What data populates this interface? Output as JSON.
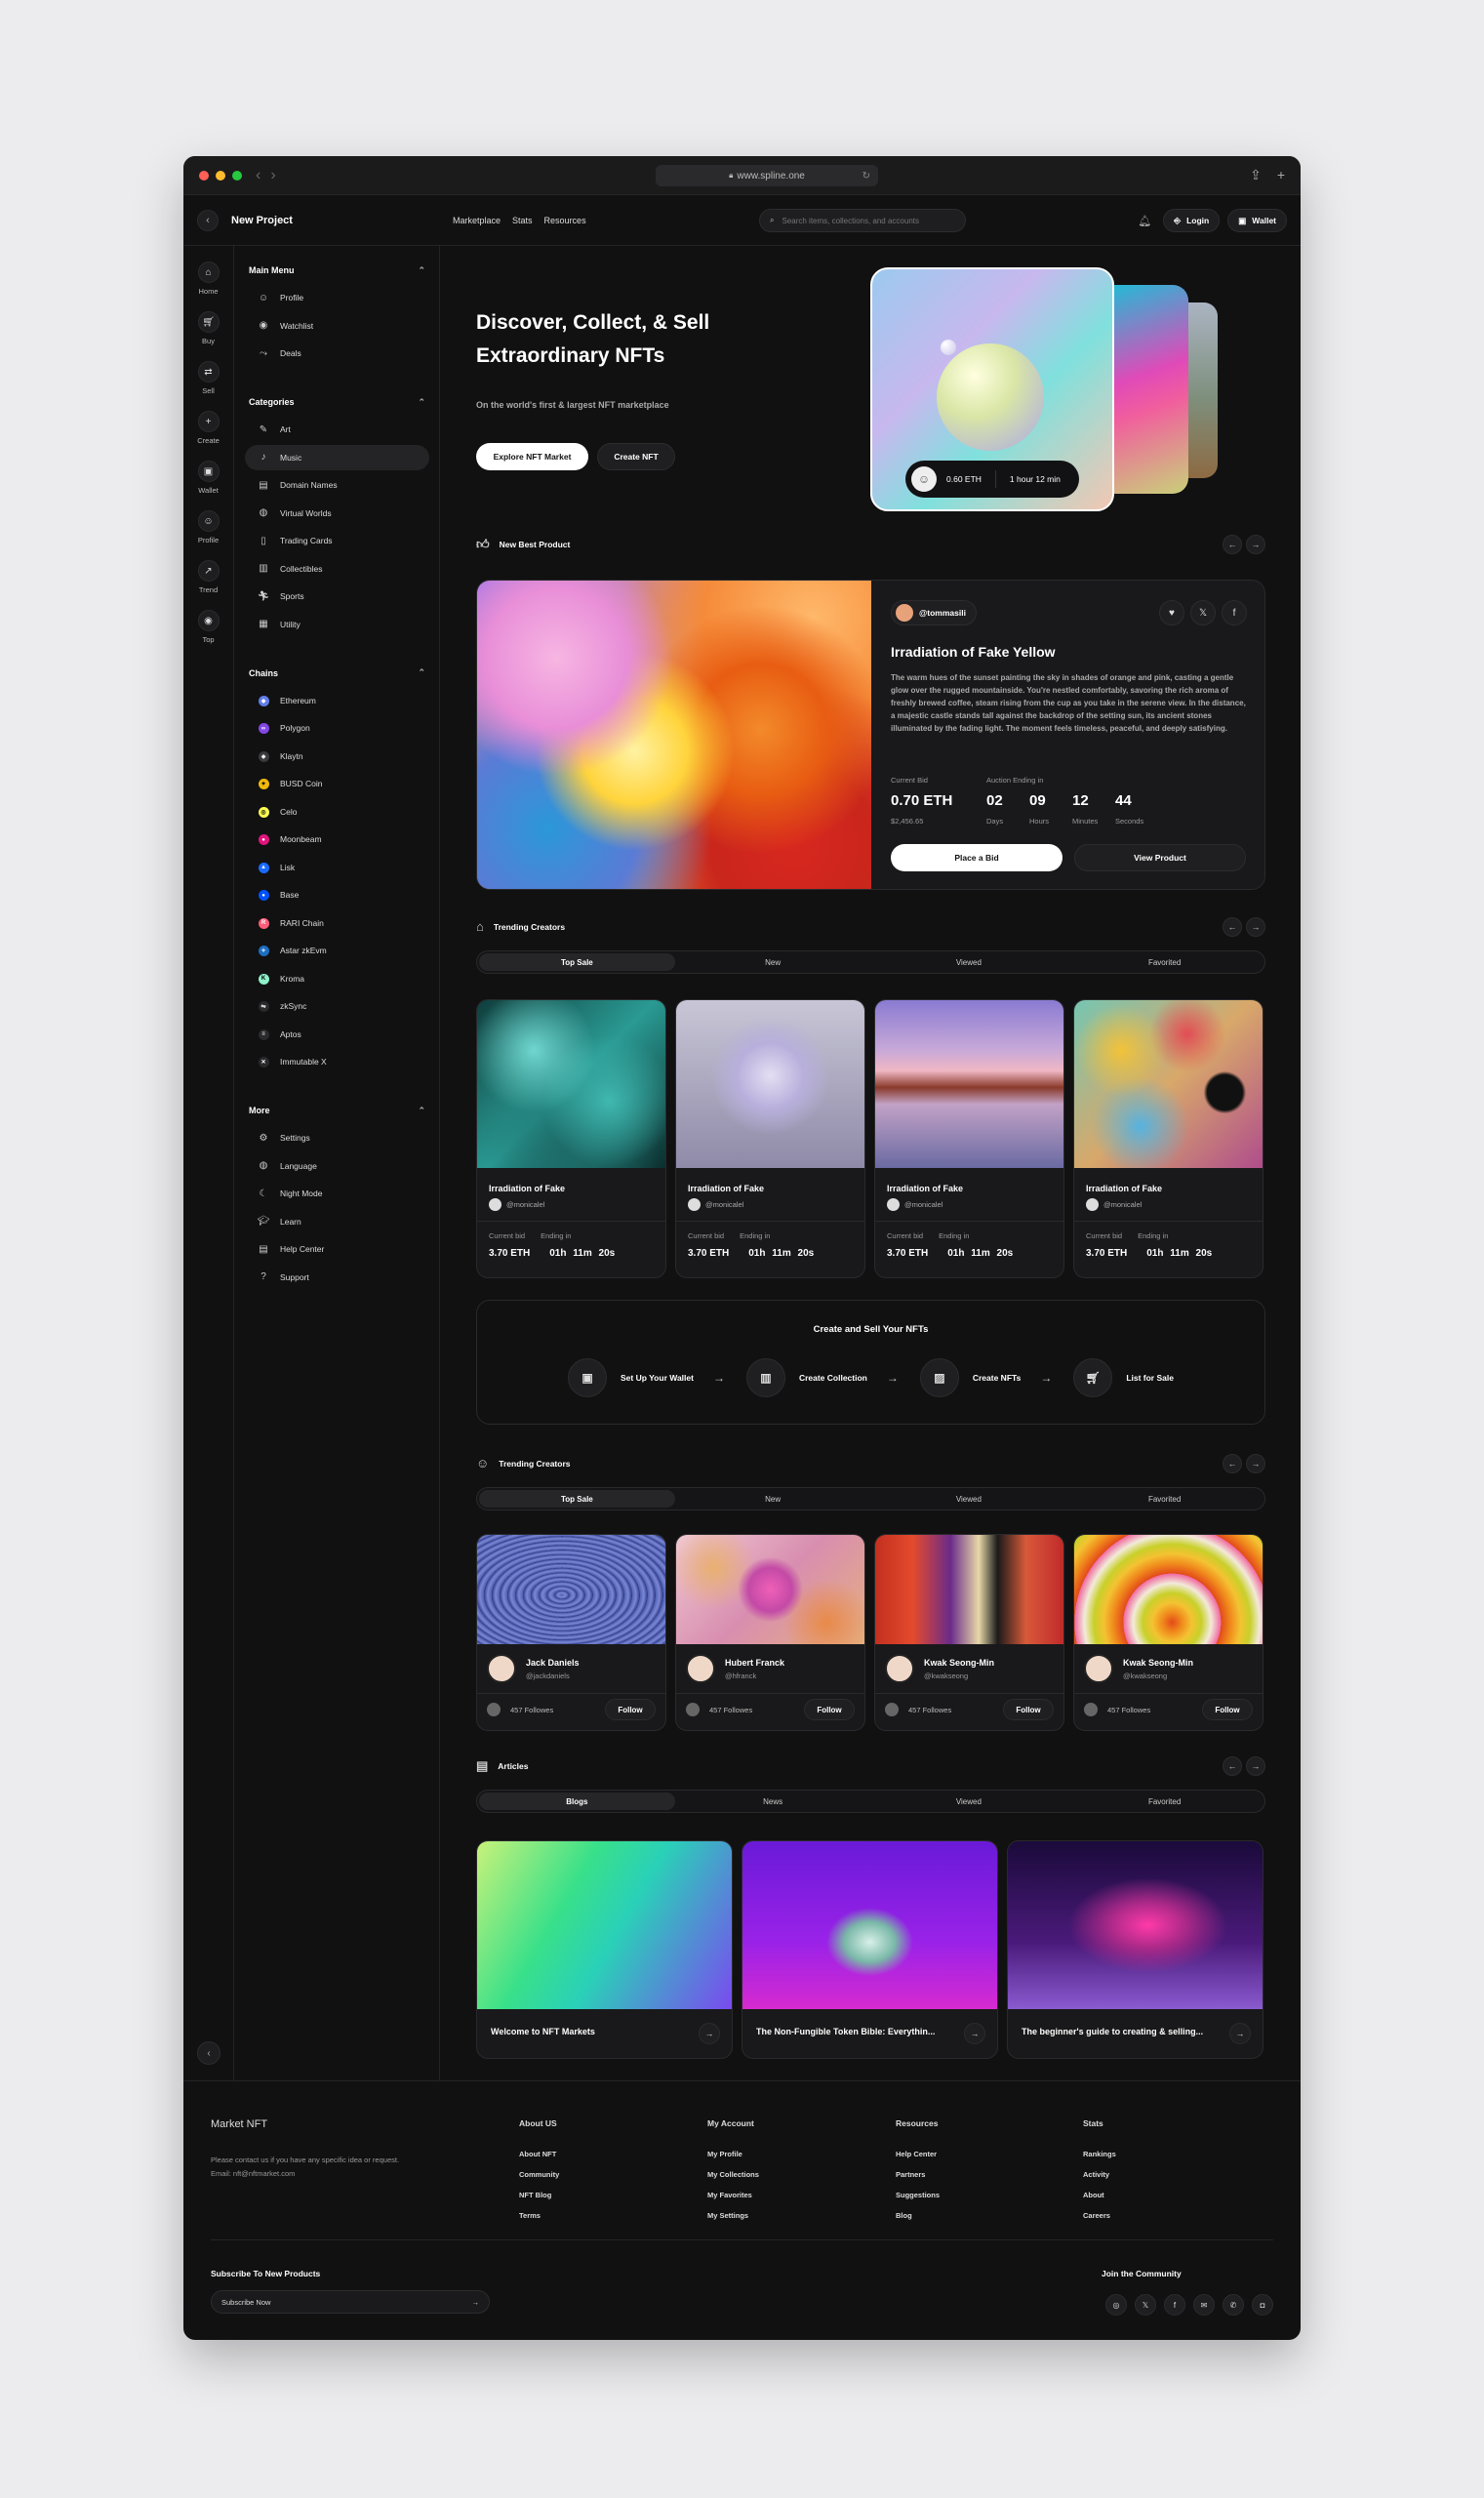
{
  "browser": {
    "url": "www.spline.one"
  },
  "topbar": {
    "title": "New Project",
    "nav": [
      "Marketplace",
      "Stats",
      "Resources"
    ],
    "search_placeholder": "Search items, collections, and accounts",
    "login": "Login",
    "wallet": "Wallet"
  },
  "rail": [
    {
      "label": "Home",
      "icon": "home-icon"
    },
    {
      "label": "Buy",
      "icon": "cart-icon"
    },
    {
      "label": "Sell",
      "icon": "sell-icon"
    },
    {
      "label": "Create",
      "icon": "plus-icon"
    },
    {
      "label": "Wallet",
      "icon": "wallet-icon"
    },
    {
      "label": "Profile",
      "icon": "user-icon"
    },
    {
      "label": "Trend",
      "icon": "trend-icon"
    },
    {
      "label": "Top",
      "icon": "top-icon"
    }
  ],
  "sidebar": {
    "main_menu": {
      "title": "Main Menu",
      "items": [
        "Profile",
        "Watchlist",
        "Deals"
      ]
    },
    "categories": {
      "title": "Categories",
      "items": [
        "Art",
        "Music",
        "Domain Names",
        "Virtual Worlds",
        "Trading Cards",
        "Collectibles",
        "Sports",
        "Utility"
      ],
      "active": "Music"
    },
    "chains": {
      "title": "Chains",
      "items": [
        {
          "name": "Ethereum",
          "color": "#627eea"
        },
        {
          "name": "Polygon",
          "color": "#8247e5"
        },
        {
          "name": "Klaytn",
          "color": "#3a3a3c"
        },
        {
          "name": "BUSD Coin",
          "color": "#f0b90b"
        },
        {
          "name": "Celo",
          "color": "#fcff52"
        },
        {
          "name": "Moonbeam",
          "color": "#e1147b"
        },
        {
          "name": "Lisk",
          "color": "#1a6aff"
        },
        {
          "name": "Base",
          "color": "#0052ff"
        },
        {
          "name": "RARI Chain",
          "color": "#ff5e7a"
        },
        {
          "name": "Astar zkEvm",
          "color": "#1b6dc1"
        },
        {
          "name": "Kroma",
          "color": "#8ef0c8"
        },
        {
          "name": "zkSync",
          "color": "#2a2a2c"
        },
        {
          "name": "Aptos",
          "color": "#2a2a2c"
        },
        {
          "name": "Immutable X",
          "color": "#2a2a2c"
        }
      ]
    },
    "more": {
      "title": "More",
      "items": [
        "Settings",
        "Language",
        "Night Mode",
        "Learn",
        "Help Center",
        "Support"
      ]
    }
  },
  "hero": {
    "title": "Discover, Collect, & Sell Extraordinary NFTs",
    "subtitle": "On the world's first & largest NFT marketplace",
    "explore": "Explore NFT Market",
    "create": "Create NFT",
    "price": "0.60 ETH",
    "time": "1 hour 12 min"
  },
  "best": {
    "heading": "New Best Product",
    "author": "@tommasili",
    "title": "Irradiation of Fake Yellow",
    "description": "The warm hues of the sunset painting the sky in shades of orange and pink, casting a gentle glow over the rugged mountainside. You're nestled comfortably, savoring the rich aroma of freshly brewed coffee, steam rising from the cup as you take in the serene view. In the distance, a majestic castle stands tall against the backdrop of the setting sun, its ancient stones illuminated by the fading light. The moment feels timeless, peaceful, and deeply satisfying.",
    "bid_label": "Current Bid",
    "bid_value": "0.70 ETH",
    "bid_usd": "$2,456.65",
    "auction_label": "Auction Ending in",
    "countdown": [
      {
        "v": "02",
        "l": "Days"
      },
      {
        "v": "09",
        "l": "Hours"
      },
      {
        "v": "12",
        "l": "Minutes"
      },
      {
        "v": "44",
        "l": "Seconds"
      }
    ],
    "place_bid": "Place a Bid",
    "view": "View Product"
  },
  "tabs": [
    "Top Sale",
    "New",
    "Viewed",
    "Favorited"
  ],
  "trending1": {
    "heading": "Trending Creators",
    "cards": [
      {
        "title": "Irradiation of Fake",
        "user": "@monicalel",
        "bid_label": "Current bid",
        "end_label": "Ending in",
        "bid": "3.70 ETH",
        "time": "01h 11m 20s"
      },
      {
        "title": "Irradiation of Fake",
        "user": "@monicalel",
        "bid_label": "Current bid",
        "end_label": "Ending in",
        "bid": "3.70 ETH",
        "time": "01h 11m 20s"
      },
      {
        "title": "Irradiation of Fake",
        "user": "@monicalel",
        "bid_label": "Current bid",
        "end_label": "Ending in",
        "bid": "3.70 ETH",
        "time": "01h 11m 20s"
      },
      {
        "title": "Irradiation of Fake",
        "user": "@monicalel",
        "bid_label": "Current bid",
        "end_label": "Ending in",
        "bid": "3.70 ETH",
        "time": "01h 11m 20s"
      }
    ]
  },
  "create": {
    "title": "Create and Sell Your NFTs",
    "steps": [
      "Set Up Your Wallet",
      "Create Collection",
      "Create NFTs",
      "List for Sale"
    ]
  },
  "trending2": {
    "heading": "Trending Creators",
    "cards": [
      {
        "name": "Jack Daniels",
        "handle": "@jackdaniels",
        "followers": "457 Followes",
        "follow": "Follow"
      },
      {
        "name": "Hubert Franck",
        "handle": "@hfranck",
        "followers": "457 Followes",
        "follow": "Follow"
      },
      {
        "name": "Kwak Seong-Min",
        "handle": "@kwakseong",
        "followers": "457 Followes",
        "follow": "Follow"
      },
      {
        "name": "Kwak Seong-Min",
        "handle": "@kwakseong",
        "followers": "457 Followes",
        "follow": "Follow"
      }
    ]
  },
  "articles": {
    "heading": "Articles",
    "tabs": [
      "Blogs",
      "News",
      "Viewed",
      "Favorited"
    ],
    "cards": [
      "Welcome to NFT Markets",
      "The Non-Fungible Token Bible: Everythin...",
      "The beginner's guide to creating & selling..."
    ]
  },
  "footer": {
    "brand": "Market NFT",
    "contact": "Please contact us if you have any specific idea or request.",
    "email": "Email: nft@nftmarket.com",
    "cols": [
      {
        "title": "About US",
        "items": [
          "About NFT",
          "Community",
          "NFT Blog",
          "Terms"
        ]
      },
      {
        "title": "My Account",
        "items": [
          "My Profile",
          "My Collections",
          "My Favorites",
          "My Settings"
        ]
      },
      {
        "title": "Resources",
        "items": [
          "Help Center",
          "Partners",
          "Suggestions",
          "Blog"
        ]
      },
      {
        "title": "Stats",
        "items": [
          "Rankings",
          "Activity",
          "About",
          "Careers"
        ]
      }
    ],
    "subscribe_title": "Subscribe To New Products",
    "subscribe_placeholder": "Subscribe Now",
    "join": "Join the Community"
  }
}
